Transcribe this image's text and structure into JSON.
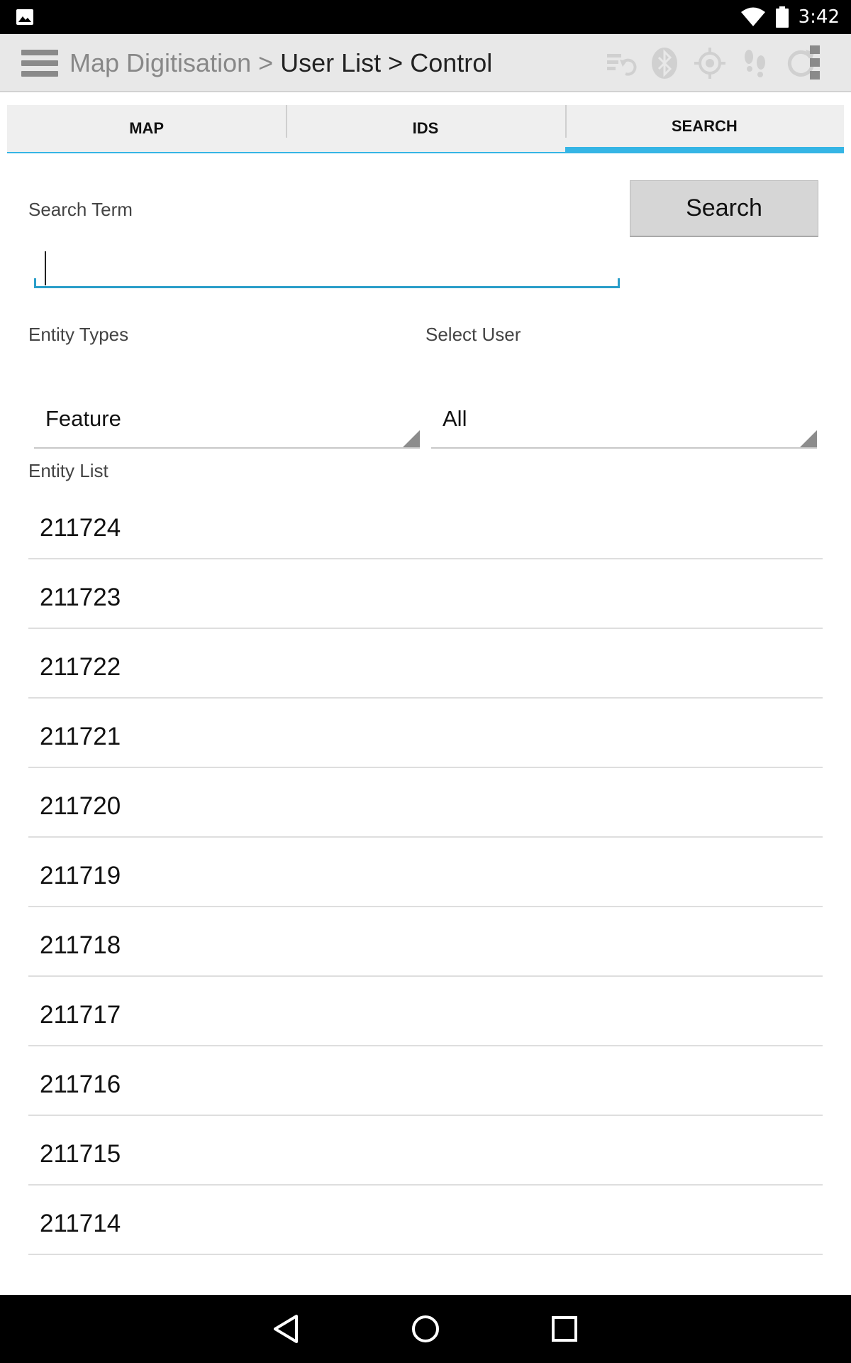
{
  "status_bar": {
    "time": "3:42"
  },
  "action_bar": {
    "crumb_app": "Map Digitisation > ",
    "crumb_path": "User List > Control"
  },
  "tabs": [
    {
      "label": "MAP",
      "active": false
    },
    {
      "label": "IDS",
      "active": false
    },
    {
      "label": "SEARCH",
      "active": true
    }
  ],
  "search": {
    "term_label": "Search Term",
    "term_value": "",
    "button_label": "Search"
  },
  "filters": {
    "entity_types_label": "Entity Types",
    "entity_types_value": "Feature",
    "select_user_label": "Select User",
    "select_user_value": "All"
  },
  "entity_list": {
    "label": "Entity List",
    "items": [
      "211724",
      "211723",
      "211722",
      "211721",
      "211720",
      "211719",
      "211718",
      "211717",
      "211716",
      "211715",
      "211714"
    ]
  },
  "colors": {
    "accent": "#35b5e5",
    "action_bar_bg": "#e8e8e8",
    "icon_disabled": "#d0d0d0"
  },
  "icons": [
    "menu-icon",
    "sync-list-icon",
    "bluetooth-icon",
    "gps-target-icon",
    "footprints-icon",
    "refresh-icon",
    "overflow-menu-icon",
    "back-icon",
    "home-icon",
    "recents-icon",
    "wifi-icon",
    "battery-icon",
    "picture-icon"
  ]
}
